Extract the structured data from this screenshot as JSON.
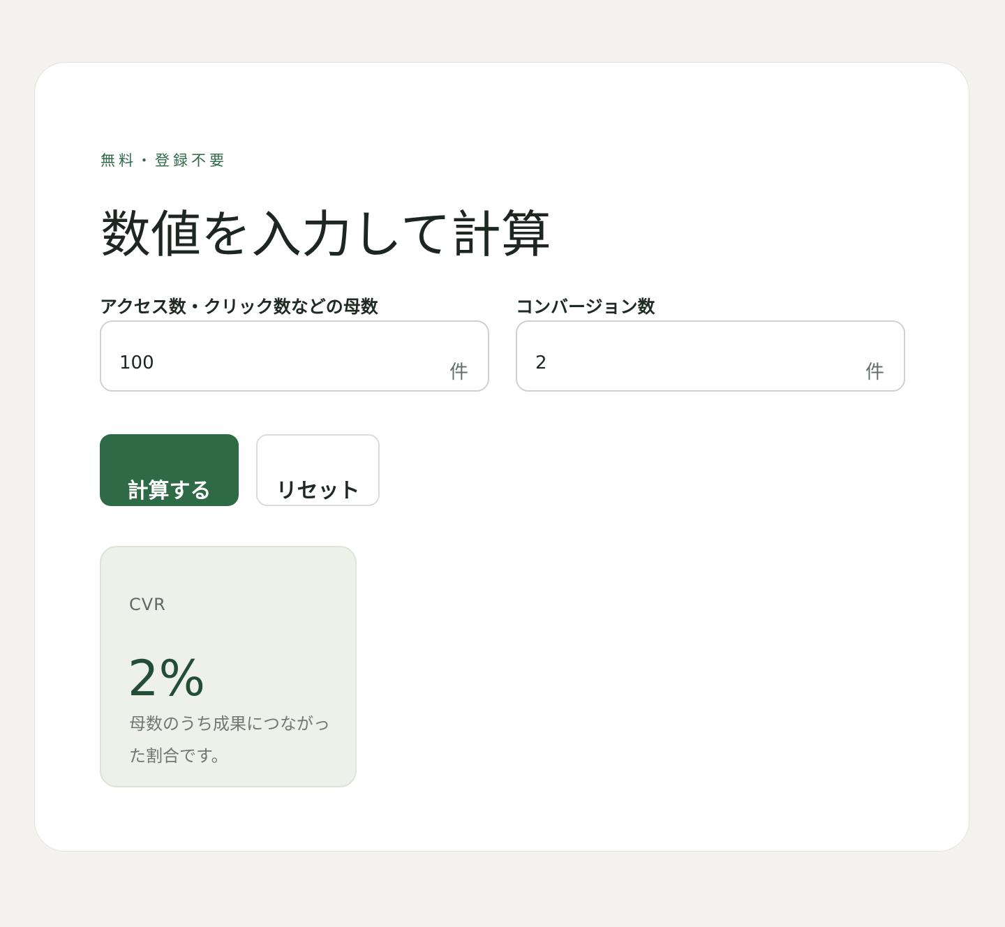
{
  "header": {
    "eyebrow": "無料・登録不要",
    "title": "数値を入力して計算"
  },
  "form": {
    "population": {
      "label": "アクセス数・クリック数などの母数",
      "value": "100",
      "unit": "件"
    },
    "conversions": {
      "label": "コンバージョン数",
      "value": "2",
      "unit": "件"
    }
  },
  "actions": {
    "calculate_label": "計算する",
    "reset_label": "リセット"
  },
  "result": {
    "label": "CVR",
    "value": "2%",
    "description": "母数のうち成果につながった割合です。"
  },
  "colors": {
    "accent": "#2f6a47",
    "background": "#f3f2ee",
    "result_background": "#eef1ea"
  }
}
